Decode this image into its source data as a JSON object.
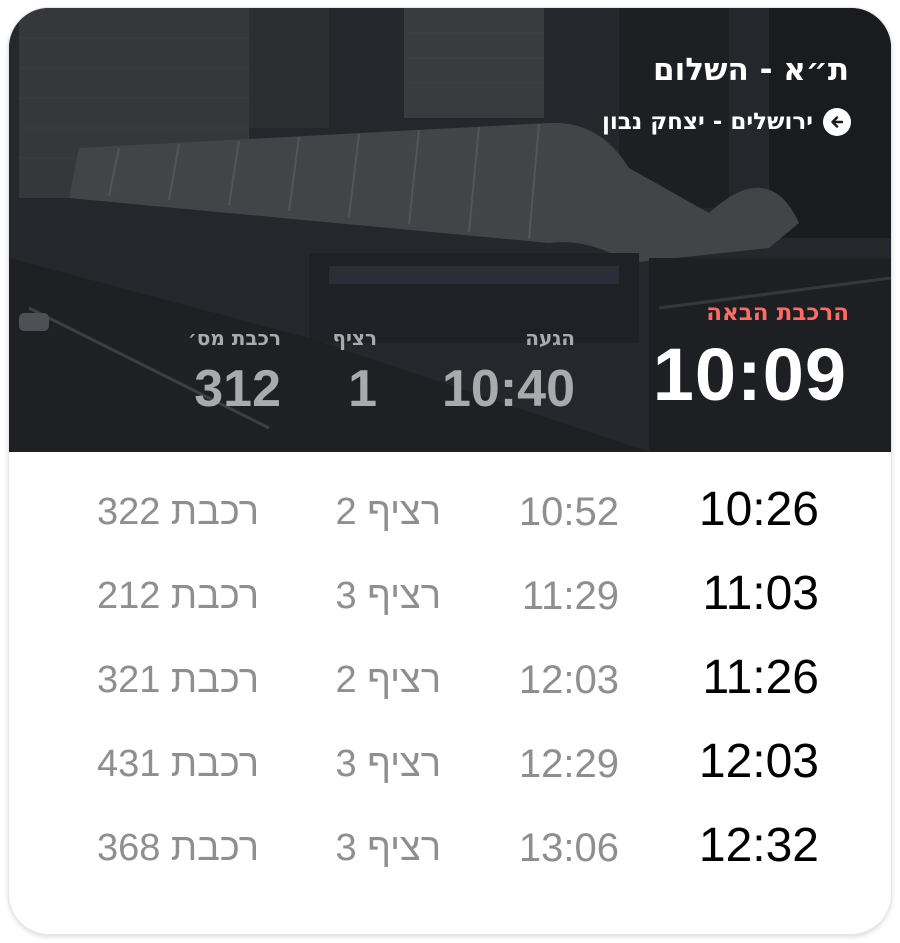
{
  "header": {
    "station": "ת״א - השלום",
    "direction": "ירושלים - יצחק נבון",
    "direction_icon": "arrow-left-circle-icon",
    "next_train_label": "הרכבת הבאה",
    "next_departure": "10:09",
    "arrival_label": "הגעה",
    "arrival": "10:40",
    "platform_label": "רציף",
    "platform": "1",
    "train_label": "רכבת מס׳",
    "train_number": "312"
  },
  "colors": {
    "accent_red": "#ff6b63",
    "muted_gray": "#8e8e93",
    "header_gray": "#a9aaad"
  },
  "schedule": [
    {
      "departure": "10:26",
      "arrival": "10:52",
      "platform": "רציף 2",
      "train": "רכבת 322"
    },
    {
      "departure": "11:03",
      "arrival": "11:29",
      "platform": "רציף 3",
      "train": "רכבת 212"
    },
    {
      "departure": "11:26",
      "arrival": "12:03",
      "platform": "רציף 2",
      "train": "רכבת 321"
    },
    {
      "departure": "12:03",
      "arrival": "12:29",
      "platform": "רציף 3",
      "train": "רכבת 431"
    },
    {
      "departure": "12:32",
      "arrival": "13:06",
      "platform": "רציף 3",
      "train": "רכבת 368"
    }
  ]
}
